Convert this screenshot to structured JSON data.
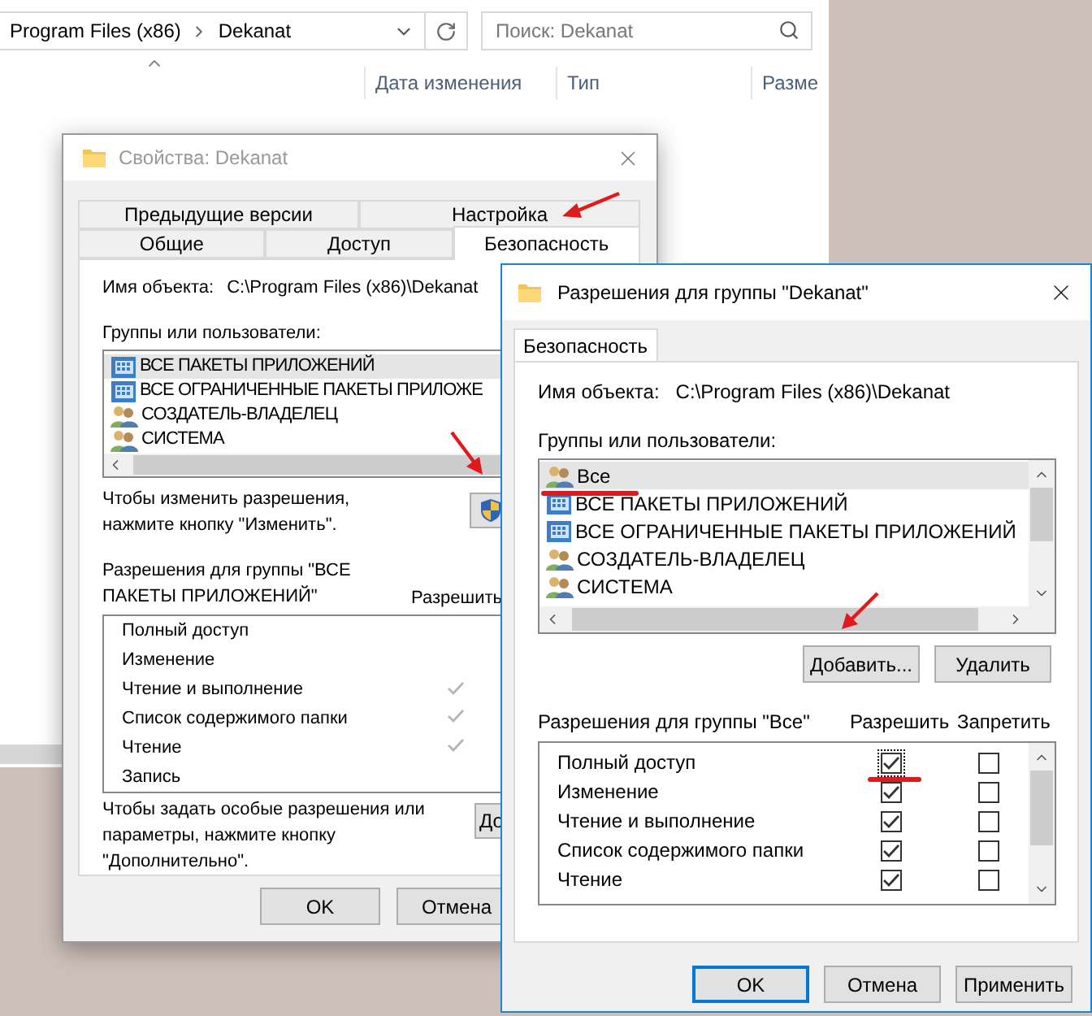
{
  "explorer": {
    "breadcrumb": [
      "Program Files (x86)",
      "Dekanat"
    ],
    "search": {
      "placeholder": "Поиск: Dekanat"
    },
    "columns": [
      "Дата изменения",
      "Тип",
      "Разме"
    ]
  },
  "properties_dialog": {
    "title": "Свойства: Dekanat",
    "tab_rows": [
      [
        {
          "label": "Предыдущие версии",
          "selected": false
        },
        {
          "label": "Настройка",
          "selected": false
        }
      ],
      [
        {
          "label": "Общие",
          "selected": false
        },
        {
          "label": "Доступ",
          "selected": false
        },
        {
          "label": "Безопасность",
          "selected": true
        }
      ]
    ],
    "object_label": "Имя объекта:",
    "object_path": "C:\\Program Files (x86)\\Dekanat",
    "groups_label": "Группы или пользователи:",
    "groups": [
      {
        "name": "ВСЕ ПАКЕТЫ ПРИЛОЖЕНИЙ",
        "kind": "package",
        "selected": true
      },
      {
        "name": "ВСЕ ОГРАНИЧЕННЫЕ ПАКЕТЫ ПРИЛОЖЕ",
        "kind": "package",
        "selected": false
      },
      {
        "name": "СОЗДАТЕЛЬ-ВЛАДЕЛЕЦ",
        "kind": "users",
        "selected": false
      },
      {
        "name": "СИСТЕМА",
        "kind": "users",
        "selected": false
      }
    ],
    "change_hint": "Чтобы изменить разрешения,\nнажмите кнопку \"Изменить\".",
    "permissions_label": "Разрешения для группы \"ВСЕ\nПАКЕТЫ ПРИЛОЖЕНИЙ\"",
    "allow_header": "Разрешить",
    "permissions": [
      {
        "name": "Полный доступ",
        "allow": false
      },
      {
        "name": "Изменение",
        "allow": false
      },
      {
        "name": "Чтение и выполнение",
        "allow": true
      },
      {
        "name": "Список содержимого папки",
        "allow": true
      },
      {
        "name": "Чтение",
        "allow": true
      },
      {
        "name": "Запись",
        "allow": false
      }
    ],
    "advanced_hint": "Чтобы задать особые разрешения или\nпараметры, нажмите кнопку\n\"Дополнительно\".",
    "advanced_button": "До",
    "buttons": [
      "OK",
      "Отмена"
    ]
  },
  "permissions_dialog": {
    "title": "Разрешения для группы \"Dekanat\"",
    "tab": "Безопасность",
    "object_label": "Имя объекта:",
    "object_path": "C:\\Program Files (x86)\\Dekanat",
    "groups_label": "Группы или пользователи:",
    "groups": [
      {
        "name": "Все",
        "kind": "users",
        "selected": true
      },
      {
        "name": "ВСЕ ПАКЕТЫ ПРИЛОЖЕНИЙ",
        "kind": "package",
        "selected": false
      },
      {
        "name": "ВСЕ ОГРАНИЧЕННЫЕ ПАКЕТЫ ПРИЛОЖЕНИЙ",
        "kind": "package",
        "selected": false
      },
      {
        "name": "СОЗДАТЕЛЬ-ВЛАДЕЛЕЦ",
        "kind": "users",
        "selected": false
      },
      {
        "name": "СИСТЕМА",
        "kind": "users",
        "selected": false
      }
    ],
    "add_button": "Добавить...",
    "remove_button": "Удалить",
    "permissions_label": "Разрешения для группы \"Все\"",
    "allow_header": "Разрешить",
    "deny_header": "Запретить",
    "permissions": [
      {
        "name": "Полный доступ",
        "allow": true,
        "deny": false,
        "focused": true
      },
      {
        "name": "Изменение",
        "allow": true,
        "deny": false,
        "focused": false
      },
      {
        "name": "Чтение и выполнение",
        "allow": true,
        "deny": false,
        "focused": false
      },
      {
        "name": "Список содержимого папки",
        "allow": true,
        "deny": false,
        "focused": false
      },
      {
        "name": "Чтение",
        "allow": true,
        "deny": false,
        "focused": false
      }
    ],
    "buttons": [
      {
        "label": "OK",
        "default": true
      },
      {
        "label": "Отмена",
        "default": false
      },
      {
        "label": "Применить",
        "default": false
      }
    ]
  }
}
